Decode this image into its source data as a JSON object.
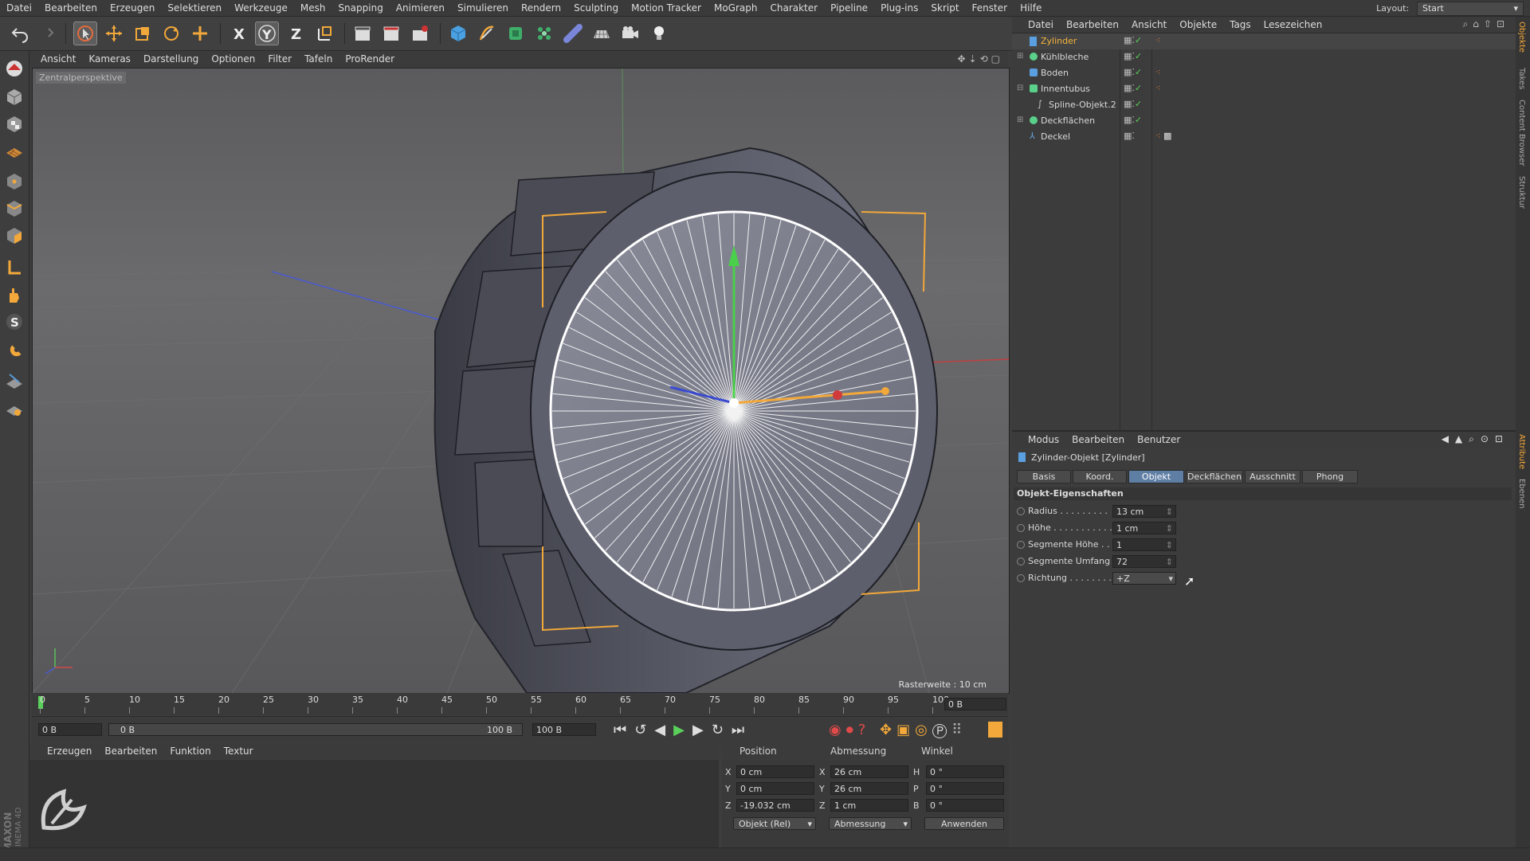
{
  "menu": [
    "Datei",
    "Bearbeiten",
    "Erzeugen",
    "Selektieren",
    "Werkzeuge",
    "Mesh",
    "Snapping",
    "Animieren",
    "Simulieren",
    "Rendern",
    "Sculpting",
    "Motion Tracker",
    "MoGraph",
    "Charakter",
    "Pipeline",
    "Plug-ins",
    "Skript",
    "Fenster",
    "Hilfe"
  ],
  "layout": {
    "label": "Layout:",
    "value": "Start"
  },
  "viewport": {
    "menu": [
      "Ansicht",
      "Kameras",
      "Darstellung",
      "Optionen",
      "Filter",
      "Tafeln",
      "ProRender"
    ],
    "label": "Zentralperspektive",
    "raster": "Rasterweite : 10 cm"
  },
  "timeline": {
    "ticks": [
      "0",
      "5",
      "10",
      "15",
      "20",
      "25",
      "30",
      "35",
      "40",
      "45",
      "50",
      "55",
      "60",
      "65",
      "70",
      "75",
      "80",
      "85",
      "90",
      "95",
      "100"
    ],
    "frame_field": "0 B",
    "start_field": "0 B",
    "range_start": "0 B",
    "range_end": "100 B",
    "end_field": "100 B"
  },
  "material": {
    "menu": [
      "Erzeugen",
      "Bearbeiten",
      "Funktion",
      "Textur"
    ]
  },
  "coords": {
    "headers": [
      "Position",
      "Abmessung",
      "Winkel"
    ],
    "rows": [
      {
        "axis": "X",
        "pos": "0 cm",
        "dim_axis": "X",
        "dim": "26 cm",
        "ang_axis": "H",
        "ang": "0 °"
      },
      {
        "axis": "Y",
        "pos": "0 cm",
        "dim_axis": "Y",
        "dim": "26 cm",
        "ang_axis": "P",
        "ang": "0 °"
      },
      {
        "axis": "Z",
        "pos": "-19.032 cm",
        "dim_axis": "Z",
        "dim": "1 cm",
        "ang_axis": "B",
        "ang": "0 °"
      }
    ],
    "mode_select": "Objekt (Rel)",
    "size_select": "Abmessung",
    "apply": "Anwenden"
  },
  "object_manager": {
    "menu": [
      "Datei",
      "Bearbeiten",
      "Ansicht",
      "Objekte",
      "Tags",
      "Lesezeichen"
    ],
    "objects": [
      {
        "name": "Zylinder",
        "active": true
      },
      {
        "name": "Kühlbleche",
        "active": false
      },
      {
        "name": "Boden",
        "active": false
      },
      {
        "name": "Innentubus",
        "active": false
      },
      {
        "name": "Spline-Objekt.2",
        "active": false
      },
      {
        "name": "Deckflächen",
        "active": false
      },
      {
        "name": "Deckel",
        "active": false
      }
    ]
  },
  "attributes": {
    "menu": [
      "Modus",
      "Bearbeiten",
      "Benutzer"
    ],
    "object_title": "Zylinder-Objekt [Zylinder]",
    "tabs": [
      "Basis",
      "Koord.",
      "Objekt",
      "Deckflächen",
      "Ausschnitt",
      "Phong"
    ],
    "active_tab": "Objekt",
    "section": "Objekt-Eigenschaften",
    "props": [
      {
        "label": "Radius . . . . . . . . .",
        "value": "13 cm"
      },
      {
        "label": "Höhe . . . . . . . . . . .",
        "value": "1 cm"
      },
      {
        "label": "Segmente Höhe . . .",
        "value": "1"
      },
      {
        "label": "Segmente Umfang .",
        "value": "72"
      },
      {
        "label": "Richtung . . . . . . . .",
        "value": "+Z"
      }
    ]
  },
  "side_tabs": [
    "Objekte",
    "Takes",
    "Content Browser",
    "Struktur",
    "Attribute",
    "Ebenen"
  ],
  "brand": {
    "line1": "MAXON",
    "line2": "CINEMA 4D"
  },
  "colors": {
    "accent": "#f4b43c",
    "tab_active": "#5e7ea4",
    "viewport_bg": "#606062"
  }
}
